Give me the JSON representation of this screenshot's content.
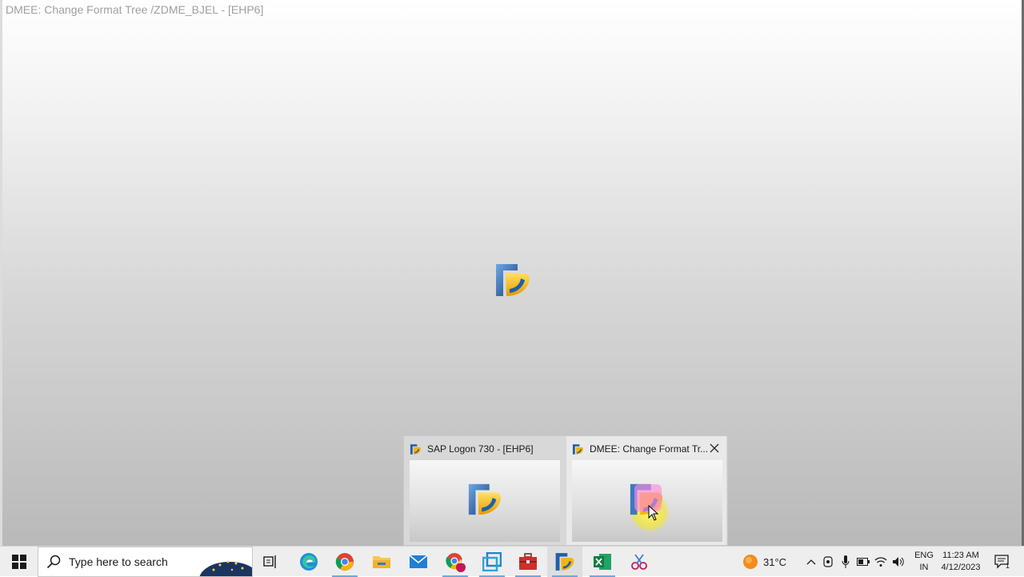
{
  "window": {
    "title": "DMEE: Change Format Tree /ZDME_BJEL - [EHP6]"
  },
  "popup": {
    "thumbnails": [
      {
        "title": "SAP Logon 730 - [EHP6]",
        "icon": "sap-logo-icon"
      },
      {
        "title": "DMEE: Change Format Tr...",
        "icon": "sap-logo-icon",
        "close_icon": "close-icon",
        "active": true
      }
    ]
  },
  "taskbar": {
    "start_icon": "windows-logo-icon",
    "search": {
      "placeholder": "Type here to search",
      "icon": "search-icon"
    },
    "apps": [
      {
        "name": "task-view",
        "icon": "task-view-icon"
      },
      {
        "name": "edge",
        "icon": "edge-icon"
      },
      {
        "name": "chrome",
        "icon": "chrome-icon"
      },
      {
        "name": "file-explorer",
        "icon": "folder-icon"
      },
      {
        "name": "mail",
        "icon": "mail-icon"
      },
      {
        "name": "chrome-profile",
        "icon": "chrome-profile-icon",
        "badge": "JB"
      },
      {
        "name": "virtual-machine",
        "icon": "vm-icon"
      },
      {
        "name": "toolbox",
        "icon": "toolbox-icon"
      },
      {
        "name": "sap-logon",
        "icon": "sap-logo-icon"
      },
      {
        "name": "excel",
        "icon": "excel-icon"
      },
      {
        "name": "snipping",
        "icon": "snipping-icon"
      }
    ],
    "weather": {
      "temp": "31°C",
      "icon": "weather-sun-icon"
    },
    "tray_icons": [
      "chevron-up-icon",
      "meet-now-icon",
      "microphone-icon",
      "battery-icon",
      "wifi-icon",
      "speaker-icon"
    ],
    "language": {
      "line1": "ENG",
      "line2": "IN"
    },
    "clock": {
      "time": "11:23 AM",
      "date": "4/12/2023"
    },
    "notifications": {
      "icon": "notification-icon",
      "count": "1"
    }
  },
  "colors": {
    "sap_blue": "#1f5fa8",
    "sap_gold": "#f2b411",
    "taskbar_bg": "#eeeeee",
    "accent_underline": "#6ea7e0"
  }
}
